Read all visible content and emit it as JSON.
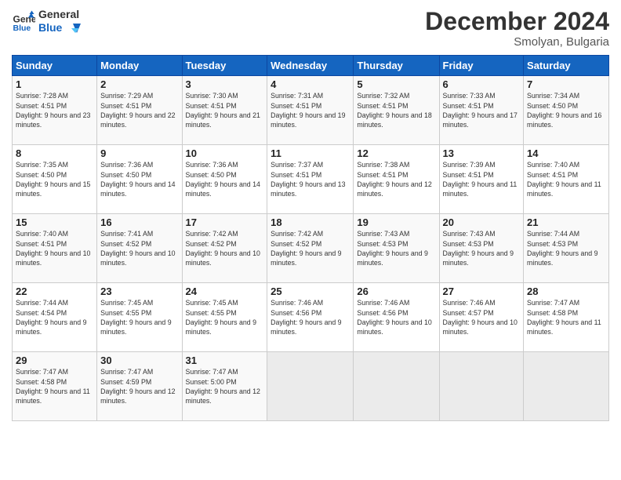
{
  "header": {
    "logo_line1": "General",
    "logo_line2": "Blue",
    "month": "December 2024",
    "location": "Smolyan, Bulgaria"
  },
  "weekdays": [
    "Sunday",
    "Monday",
    "Tuesday",
    "Wednesday",
    "Thursday",
    "Friday",
    "Saturday"
  ],
  "weeks": [
    [
      {
        "day": "1",
        "sunrise": "7:28 AM",
        "sunset": "4:51 PM",
        "daylight": "9 hours and 23 minutes."
      },
      {
        "day": "2",
        "sunrise": "7:29 AM",
        "sunset": "4:51 PM",
        "daylight": "9 hours and 22 minutes."
      },
      {
        "day": "3",
        "sunrise": "7:30 AM",
        "sunset": "4:51 PM",
        "daylight": "9 hours and 21 minutes."
      },
      {
        "day": "4",
        "sunrise": "7:31 AM",
        "sunset": "4:51 PM",
        "daylight": "9 hours and 19 minutes."
      },
      {
        "day": "5",
        "sunrise": "7:32 AM",
        "sunset": "4:51 PM",
        "daylight": "9 hours and 18 minutes."
      },
      {
        "day": "6",
        "sunrise": "7:33 AM",
        "sunset": "4:51 PM",
        "daylight": "9 hours and 17 minutes."
      },
      {
        "day": "7",
        "sunrise": "7:34 AM",
        "sunset": "4:50 PM",
        "daylight": "9 hours and 16 minutes."
      }
    ],
    [
      {
        "day": "8",
        "sunrise": "7:35 AM",
        "sunset": "4:50 PM",
        "daylight": "9 hours and 15 minutes."
      },
      {
        "day": "9",
        "sunrise": "7:36 AM",
        "sunset": "4:50 PM",
        "daylight": "9 hours and 14 minutes."
      },
      {
        "day": "10",
        "sunrise": "7:36 AM",
        "sunset": "4:50 PM",
        "daylight": "9 hours and 14 minutes."
      },
      {
        "day": "11",
        "sunrise": "7:37 AM",
        "sunset": "4:51 PM",
        "daylight": "9 hours and 13 minutes."
      },
      {
        "day": "12",
        "sunrise": "7:38 AM",
        "sunset": "4:51 PM",
        "daylight": "9 hours and 12 minutes."
      },
      {
        "day": "13",
        "sunrise": "7:39 AM",
        "sunset": "4:51 PM",
        "daylight": "9 hours and 11 minutes."
      },
      {
        "day": "14",
        "sunrise": "7:40 AM",
        "sunset": "4:51 PM",
        "daylight": "9 hours and 11 minutes."
      }
    ],
    [
      {
        "day": "15",
        "sunrise": "7:40 AM",
        "sunset": "4:51 PM",
        "daylight": "9 hours and 10 minutes."
      },
      {
        "day": "16",
        "sunrise": "7:41 AM",
        "sunset": "4:52 PM",
        "daylight": "9 hours and 10 minutes."
      },
      {
        "day": "17",
        "sunrise": "7:42 AM",
        "sunset": "4:52 PM",
        "daylight": "9 hours and 10 minutes."
      },
      {
        "day": "18",
        "sunrise": "7:42 AM",
        "sunset": "4:52 PM",
        "daylight": "9 hours and 9 minutes."
      },
      {
        "day": "19",
        "sunrise": "7:43 AM",
        "sunset": "4:53 PM",
        "daylight": "9 hours and 9 minutes."
      },
      {
        "day": "20",
        "sunrise": "7:43 AM",
        "sunset": "4:53 PM",
        "daylight": "9 hours and 9 minutes."
      },
      {
        "day": "21",
        "sunrise": "7:44 AM",
        "sunset": "4:53 PM",
        "daylight": "9 hours and 9 minutes."
      }
    ],
    [
      {
        "day": "22",
        "sunrise": "7:44 AM",
        "sunset": "4:54 PM",
        "daylight": "9 hours and 9 minutes."
      },
      {
        "day": "23",
        "sunrise": "7:45 AM",
        "sunset": "4:55 PM",
        "daylight": "9 hours and 9 minutes."
      },
      {
        "day": "24",
        "sunrise": "7:45 AM",
        "sunset": "4:55 PM",
        "daylight": "9 hours and 9 minutes."
      },
      {
        "day": "25",
        "sunrise": "7:46 AM",
        "sunset": "4:56 PM",
        "daylight": "9 hours and 9 minutes."
      },
      {
        "day": "26",
        "sunrise": "7:46 AM",
        "sunset": "4:56 PM",
        "daylight": "9 hours and 10 minutes."
      },
      {
        "day": "27",
        "sunrise": "7:46 AM",
        "sunset": "4:57 PM",
        "daylight": "9 hours and 10 minutes."
      },
      {
        "day": "28",
        "sunrise": "7:47 AM",
        "sunset": "4:58 PM",
        "daylight": "9 hours and 11 minutes."
      }
    ],
    [
      {
        "day": "29",
        "sunrise": "7:47 AM",
        "sunset": "4:58 PM",
        "daylight": "9 hours and 11 minutes."
      },
      {
        "day": "30",
        "sunrise": "7:47 AM",
        "sunset": "4:59 PM",
        "daylight": "9 hours and 12 minutes."
      },
      {
        "day": "31",
        "sunrise": "7:47 AM",
        "sunset": "5:00 PM",
        "daylight": "9 hours and 12 minutes."
      },
      null,
      null,
      null,
      null
    ]
  ]
}
